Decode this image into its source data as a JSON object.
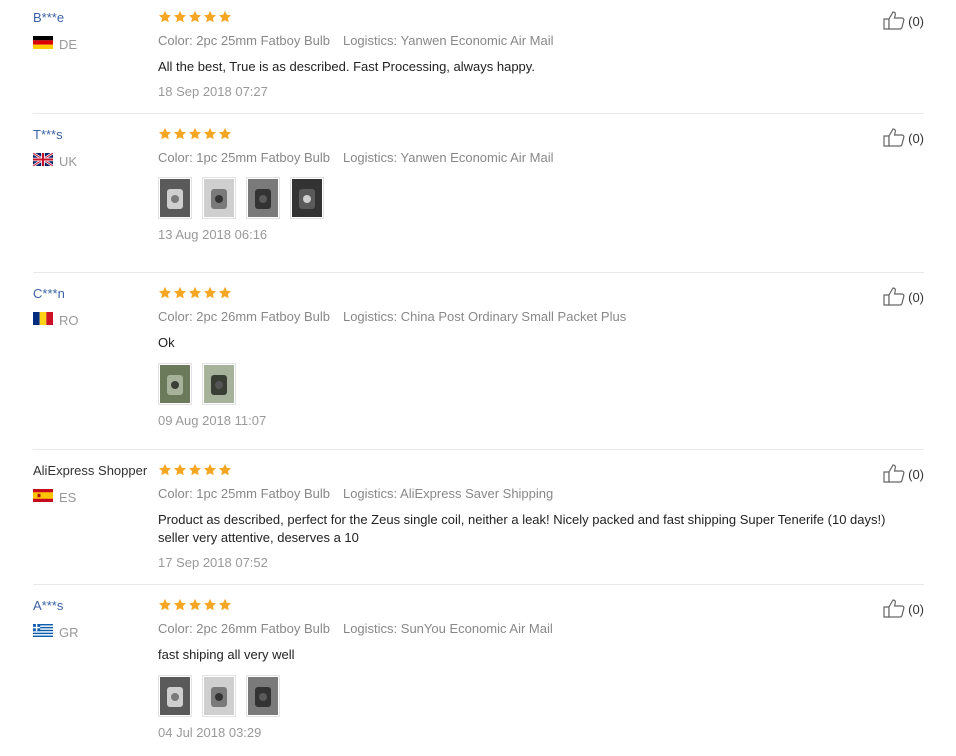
{
  "reviews": [
    {
      "user": "B***e",
      "country_code": "DE",
      "flag": "de",
      "stars": 5,
      "color": "Color: 2pc 25mm Fatboy Bulb",
      "logistics": "Logistics: Yanwen Economic Air Mail",
      "text": "All the best, True is as described. Fast Processing, always happy.",
      "date": "18 Sep 2018 07:27",
      "helpful": "(0)",
      "photos": []
    },
    {
      "user": "T***s",
      "country_code": "UK",
      "flag": "uk",
      "stars": 5,
      "color": "Color: 1pc 25mm Fatboy Bulb",
      "logistics": "Logistics: Yanwen Economic Air Mail",
      "text": "",
      "date": "13 Aug 2018 06:16",
      "helpful": "(0)",
      "photos": [
        "photo-1",
        "photo-2",
        "photo-3",
        "photo-4"
      ]
    },
    {
      "user": "C***n",
      "country_code": "RO",
      "flag": "ro",
      "stars": 5,
      "color": "Color: 2pc 26mm Fatboy Bulb",
      "logistics": "Logistics: China Post Ordinary Small Packet Plus",
      "text": "Ok",
      "date": "09 Aug 2018 11:07",
      "helpful": "(0)",
      "photos": [
        "photo-1",
        "photo-2"
      ]
    },
    {
      "user": "AliExpress Shopper",
      "country_code": "ES",
      "flag": "es",
      "stars": 5,
      "color": "Color: 1pc 25mm Fatboy Bulb",
      "logistics": "Logistics: AliExpress Saver Shipping",
      "text": "Product as described, perfect for the Zeus single coil, neither a leak! Nicely packed and fast shipping Super Tenerife (10 days!) seller very attentive, deserves a 10",
      "date": "17 Sep 2018 07:52",
      "helpful": "(0)",
      "photos": []
    },
    {
      "user": "A***s",
      "country_code": "GR",
      "flag": "gr",
      "stars": 5,
      "color": "Color: 2pc 26mm Fatboy Bulb",
      "logistics": "Logistics: SunYou Economic Air Mail",
      "text": "fast shiping all very well",
      "date": "04 Jul 2018 03:29",
      "helpful": "(0)",
      "photos": [
        "photo-1",
        "photo-2",
        "photo-3"
      ]
    }
  ],
  "colors": {
    "star": "#f5a623",
    "username": "#3c63a6",
    "meta": "#888888",
    "divider": "#e8e8e8"
  },
  "icons": {
    "star": "star-icon",
    "helpful": "thumbs-up-icon"
  }
}
